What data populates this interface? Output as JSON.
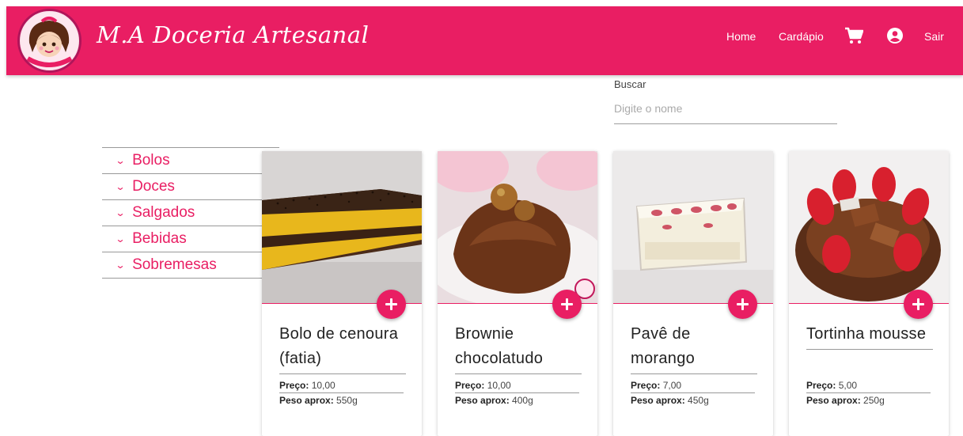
{
  "header": {
    "brand": "M.A Doceria Artesanal",
    "nav": {
      "home": "Home",
      "menu": "Cardápio",
      "logout": "Sair"
    },
    "icons": [
      "cart-icon",
      "user-icon"
    ],
    "color": "#e91e63"
  },
  "search": {
    "label": "Buscar",
    "placeholder": "Digite o nome"
  },
  "categories": [
    "Bolos",
    "Doces",
    "Salgados",
    "Bebidas",
    "Sobremesas"
  ],
  "labels": {
    "price": "Preço:",
    "weight": "Peso aprox:"
  },
  "products": [
    {
      "name": "Bolo de cenoura (fatia)",
      "price": "10,00",
      "weight": "550g"
    },
    {
      "name": "Brownie chocolatudo",
      "price": "10,00",
      "weight": "400g"
    },
    {
      "name": "Pavê de morango",
      "price": "7,00",
      "weight": "450g"
    },
    {
      "name": "Tortinha mousse",
      "price": "5,00",
      "weight": "250g"
    }
  ]
}
